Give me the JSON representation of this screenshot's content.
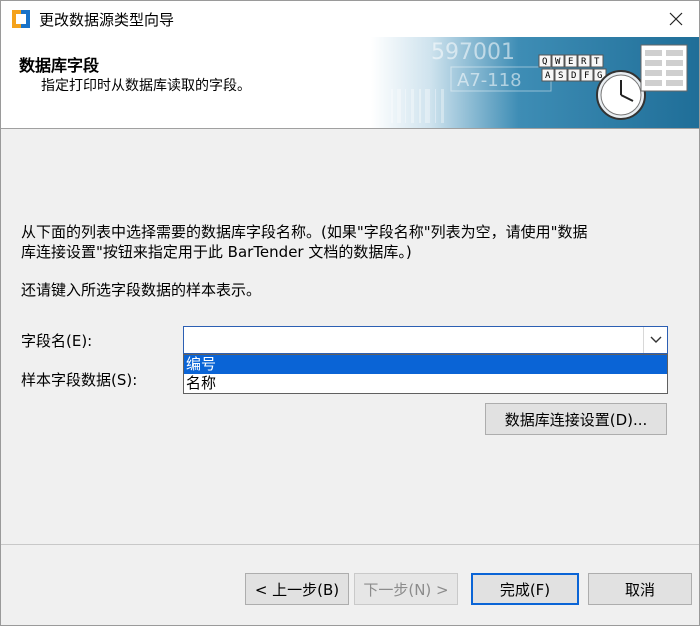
{
  "window": {
    "title": "更改数据源类型向导"
  },
  "header": {
    "title": "数据库字段",
    "subtitle": "指定打印时从数据库读取的字段。",
    "banner": {
      "number_text": "597001",
      "code_text": "A7-118",
      "keys_row1": [
        "Q",
        "W",
        "E",
        "R",
        "T"
      ],
      "keys_row2": [
        "A",
        "S",
        "D",
        "F",
        "G"
      ]
    }
  },
  "content": {
    "instruction_line1": "从下面的列表中选择需要的数据库字段名称。(如果\"字段名称\"列表为空，请使用\"数据",
    "instruction_line2": "库连接设置\"按钮来指定用于此 BarTender 文档的数据库。)",
    "sample_instruction": "还请键入所选字段数据的样本表示。",
    "field_name_label": "字段名(E):",
    "field_name_value": "",
    "sample_field_label": "样本字段数据(S):",
    "dropdown_options": [
      "编号",
      "名称"
    ],
    "selected_option_index": 0,
    "db_connection_button": "数据库连接设置(D)..."
  },
  "footer": {
    "back_button": "< 上一步(B)",
    "next_button": "下一步(N) >",
    "finish_button": "完成(F)",
    "cancel_button": "取消"
  },
  "colors": {
    "accent": "#0a64d6",
    "banner": "#2e7fa8"
  }
}
